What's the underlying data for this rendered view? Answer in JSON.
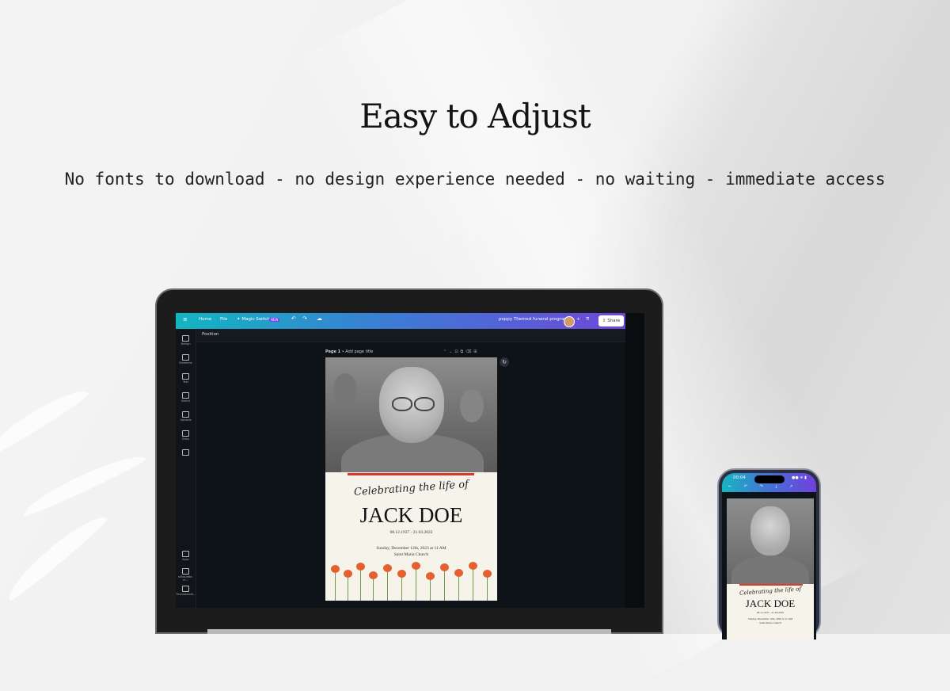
{
  "hero": {
    "title": "Easy to Adjust",
    "subtitle": "No fonts to download - no design experience needed - no waiting - immediate access"
  },
  "editor": {
    "topbar": {
      "menu_icon": "hamburger-icon",
      "home": "Home",
      "file": "File",
      "magic_switch": "Magic Switch",
      "new_badge": "NEW",
      "project_title": "poppy Themed funeral program",
      "share": "Share"
    },
    "toolbar_label": "Position",
    "sidebar": [
      {
        "icon": "design-icon",
        "label": "Design"
      },
      {
        "icon": "elements-icon",
        "label": "Elements"
      },
      {
        "icon": "text-icon",
        "label": "Text"
      },
      {
        "icon": "brand-icon",
        "label": "Brand"
      },
      {
        "icon": "uploads-icon",
        "label": "Uploads"
      },
      {
        "icon": "draw-icon",
        "label": "Draw"
      },
      {
        "icon": "folder-icon",
        "label": ""
      },
      {
        "icon": "apps-icon",
        "label": "Apps"
      },
      {
        "icon": "image-icon",
        "label": "silhouette-m..."
      },
      {
        "icon": "image-icon",
        "label": "Thomasandt..."
      }
    ],
    "page_label": "Page 1",
    "page_title_placeholder": "Add page title"
  },
  "program": {
    "script_line": "Celebrating the life of",
    "name": "JACK DOE",
    "dates": "08.12.1937 - 21.03.2022",
    "service_line1": "Sunday, December 12th, 2023 at 11 AM",
    "service_line2": "Saint Maria Church"
  },
  "phone": {
    "time": "00:04",
    "status": "●● ≡ ▮",
    "tools": "← ↶ ↷ ⤓ ↗"
  }
}
